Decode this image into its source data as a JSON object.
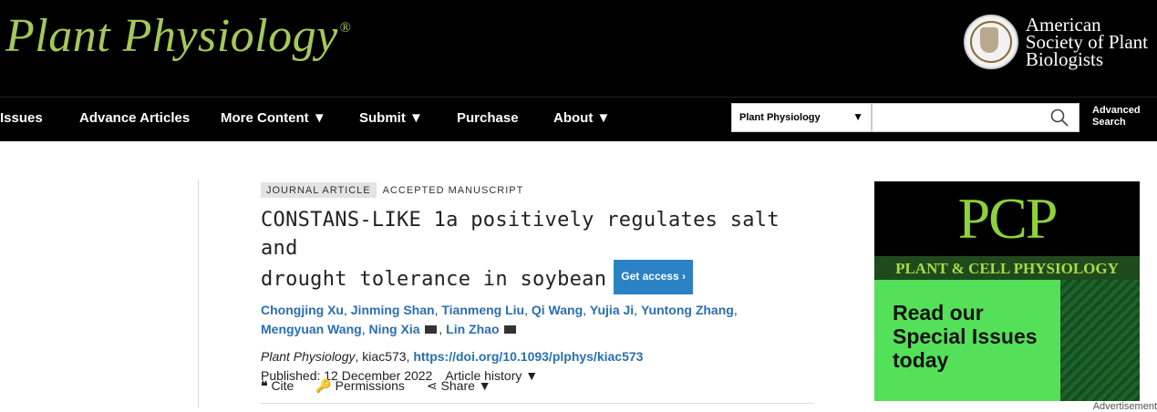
{
  "masthead": {
    "brand": "Plant Physiology",
    "brand_mark": "®",
    "society_line1": "American",
    "society_line2": "Society of Plant",
    "society_line3": "Biologists"
  },
  "nav": {
    "items": [
      "Issues",
      "Advance Articles",
      "More Content ▼",
      "Submit ▼",
      "Purchase",
      "About ▼"
    ],
    "search_scope": "Plant Physiology",
    "search_placeholder": "",
    "advanced_line1": "Advanced",
    "advanced_line2": "Search"
  },
  "article": {
    "tag_type": "JOURNAL ARTICLE",
    "tag_status": "ACCEPTED MANUSCRIPT",
    "title_line1": "CONSTANS-LIKE 1a positively regulates salt and",
    "title_line2": "drought tolerance in soybean",
    "get_access": "Get access ›",
    "authors": [
      "Chongjing Xu",
      "Jinming Shan",
      "Tianmeng Liu",
      "Qi Wang",
      "Yujia Ji",
      "Yuntong Zhang",
      "Mengyuan Wang",
      "Ning Xia",
      "Lin Zhao"
    ],
    "journal": "Plant Physiology",
    "article_id": ", kiac573, ",
    "doi": "https://doi.org/10.1093/plphys/kiac573",
    "published": "Published:  12 December 2022",
    "history": "Article history ▼",
    "tools": {
      "cite": "Cite",
      "permissions": "Permissions",
      "share": "Share ▼"
    }
  },
  "ad": {
    "logo": "PCP",
    "band": "PLANT & CELL PHYSIOLOGY",
    "cta_line1": "Read our",
    "cta_line2": "Special Issues",
    "cta_line3": "today",
    "label": "Advertisement"
  },
  "colors": {
    "brand_green": "#a4c85a",
    "link_blue": "#2a6fb0",
    "access_blue": "#2a82c4",
    "ad_green": "#55e05a"
  }
}
